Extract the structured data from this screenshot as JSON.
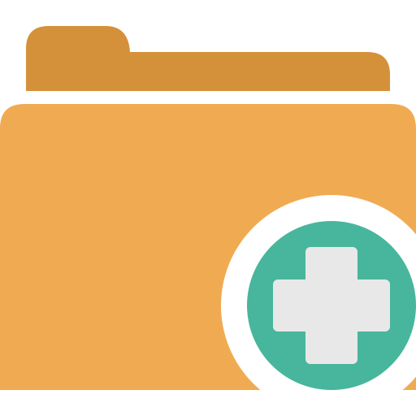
{
  "icon": {
    "name": "folder-add-icon",
    "colors": {
      "folder_back": "#D4913A",
      "folder_front": "#F0AB52",
      "ring": "#FFFFFF",
      "badge": "#47B69C",
      "plus": "#E8E8E8"
    }
  }
}
